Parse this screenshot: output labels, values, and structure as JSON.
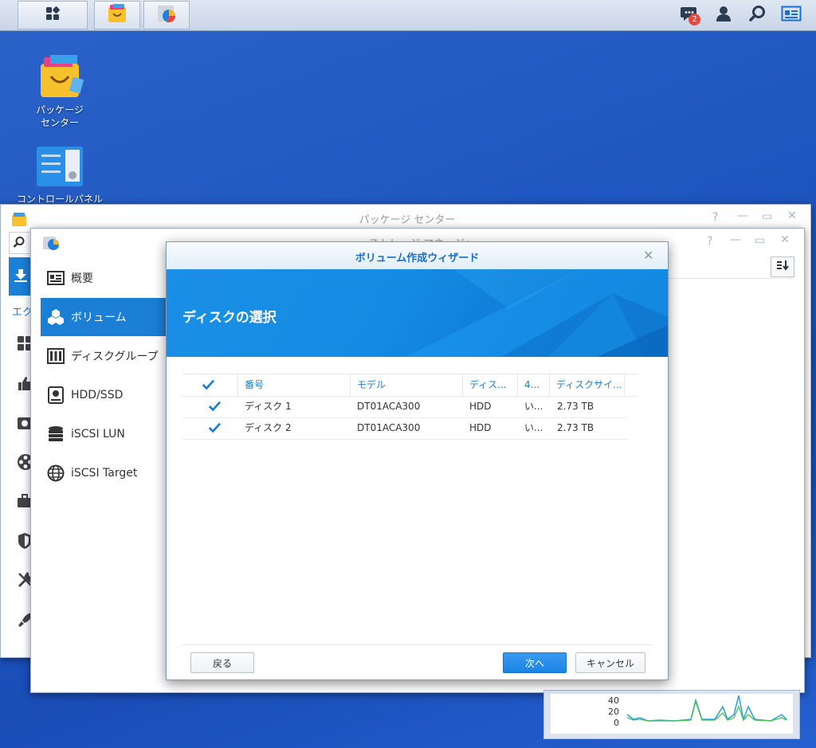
{
  "taskbar": {
    "notification_count": "2"
  },
  "desktop": {
    "icons": [
      {
        "label_line1": "パッケージ",
        "label_line2": "センター"
      },
      {
        "label_line1": "コントロールパネル",
        "label_line2": ""
      }
    ]
  },
  "package_window": {
    "title": "パッケージ センター",
    "sidebar_partial": "エク"
  },
  "storage_window": {
    "title": "ストレージ マネージャ",
    "sidebar": [
      {
        "label": "概要",
        "icon": "overview-icon"
      },
      {
        "label": "ボリューム",
        "icon": "volume-icon"
      },
      {
        "label": "ディスクグループ",
        "icon": "disk-group-icon"
      },
      {
        "label": "HDD/SSD",
        "icon": "hdd-icon"
      },
      {
        "label": "iSCSI LUN",
        "icon": "iscsi-lun-icon"
      },
      {
        "label": "iSCSI Target",
        "icon": "iscsi-target-icon"
      }
    ]
  },
  "wizard": {
    "title": "ボリューム作成ウィザード",
    "banner_title": "ディスクの選択",
    "columns": [
      "番号",
      "モデル",
      "ディス...",
      "4...",
      "ディスクサイ..."
    ],
    "rows": [
      {
        "checked": true,
        "number": "ディスク 1",
        "model": "DT01ACA300",
        "type": "HDD",
        "c4": "い...",
        "size": "2.73 TB"
      },
      {
        "checked": true,
        "number": "ディスク 2",
        "model": "DT01ACA300",
        "type": "HDD",
        "c4": "い...",
        "size": "2.73 TB"
      }
    ],
    "back_label": "戻る",
    "next_label": "次へ",
    "cancel_label": "キャンセル"
  },
  "widget": {
    "y_ticks": [
      "40",
      "20",
      "0"
    ]
  },
  "colors": {
    "accent": "#1a7fd5",
    "desktop": "#1f56c0"
  }
}
